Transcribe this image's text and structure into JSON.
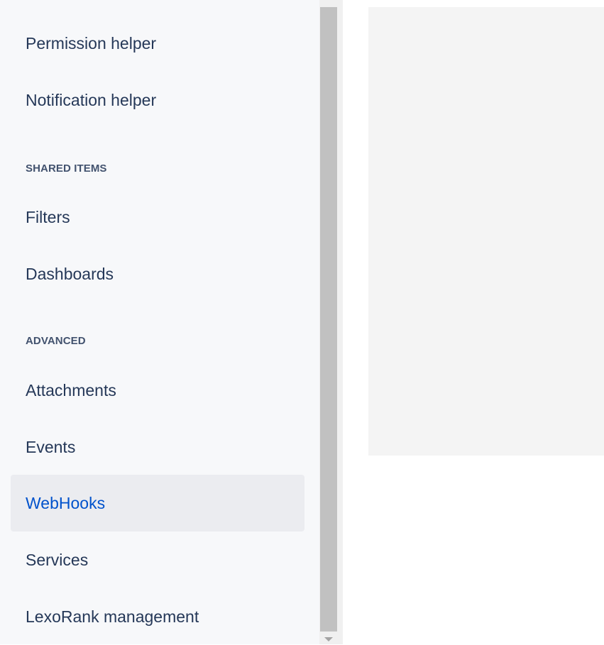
{
  "sidebar": {
    "items": [
      {
        "label": "Permission helper"
      },
      {
        "label": "Notification helper"
      },
      {
        "label": "Filters"
      },
      {
        "label": "Dashboards"
      },
      {
        "label": "Attachments"
      },
      {
        "label": "Events"
      },
      {
        "label": "WebHooks",
        "active": true
      },
      {
        "label": "Services"
      },
      {
        "label": "LexoRank management"
      }
    ],
    "sections": {
      "shared_items": "SHARED ITEMS",
      "advanced": "ADVANCED"
    }
  },
  "colors": {
    "sidebar_bg": "#f7f8fa",
    "active_bg": "#ebecf0",
    "active_text": "#0052cc",
    "text": "#253858",
    "content_bg": "#f4f4f4"
  }
}
